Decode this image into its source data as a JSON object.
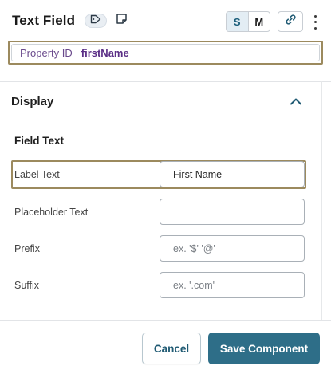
{
  "header": {
    "title": "Text Field",
    "size_options": [
      "S",
      "M"
    ],
    "active_size": "S",
    "icons": [
      "tag-icon",
      "note-icon",
      "link-icon",
      "kebab-menu-icon"
    ]
  },
  "property": {
    "label": "Property ID",
    "value": "firstName"
  },
  "display": {
    "title": "Display",
    "collapse_icon": "chevron-up-icon",
    "field_text_heading": "Field Text",
    "fields": [
      {
        "label": "Label Text",
        "value": "First Name",
        "placeholder": ""
      },
      {
        "label": "Placeholder Text",
        "value": "",
        "placeholder": ""
      },
      {
        "label": "Prefix",
        "value": "",
        "placeholder": "ex. '$' '@'"
      },
      {
        "label": "Suffix",
        "value": "",
        "placeholder": "ex. '.com'"
      }
    ]
  },
  "footer": {
    "cancel_label": "Cancel",
    "save_label": "Save Component"
  },
  "colors": {
    "accent": "#2e6e88",
    "highlight_border": "#9c8a5e",
    "property_value": "#5b2f86"
  }
}
